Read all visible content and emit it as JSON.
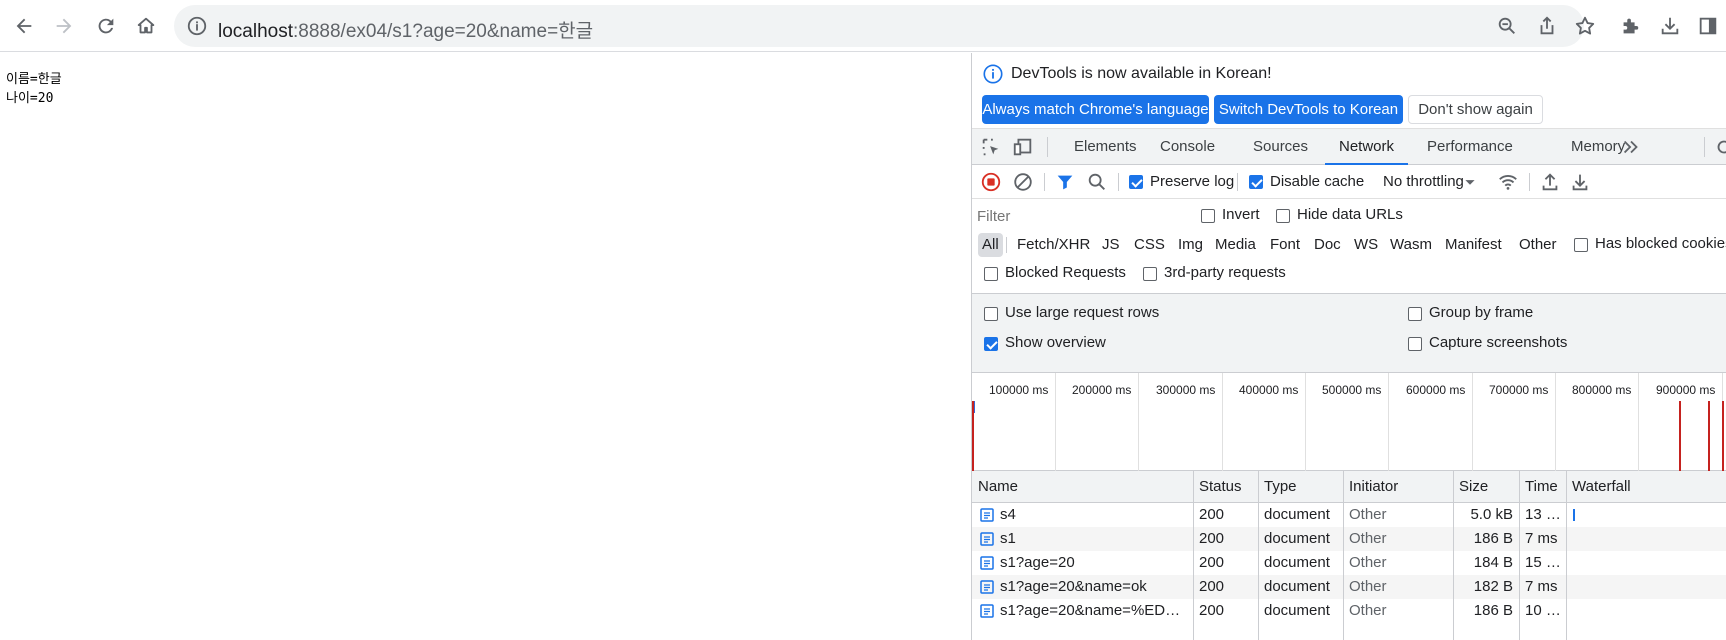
{
  "browser": {
    "url_host": "localhost",
    "url_rest": ":8888/ex04/s1?age=20&name=한글"
  },
  "page": {
    "lines": [
      "이름=한글",
      "나이=20"
    ]
  },
  "devtools": {
    "info_message": "DevTools is now available in Korean!",
    "buttons": {
      "match": "Always match Chrome's language",
      "switch": "Switch DevTools to Korean",
      "dismiss": "Don't show again"
    },
    "tabs": [
      "Elements",
      "Console",
      "Sources",
      "Network",
      "Performance",
      "Memory"
    ],
    "active_tab": "Network",
    "network_toolbar": {
      "preserve_log": "Preserve log",
      "disable_cache": "Disable cache",
      "throttling": "No throttling"
    },
    "filter": {
      "placeholder": "Filter",
      "invert": "Invert",
      "hide_data_urls": "Hide data URLs",
      "types": [
        "All",
        "Fetch/XHR",
        "JS",
        "CSS",
        "Img",
        "Media",
        "Font",
        "Doc",
        "WS",
        "Wasm",
        "Manifest",
        "Other"
      ],
      "has_blocked_cookies": "Has blocked cookies",
      "blocked_requests": "Blocked Requests",
      "third_party": "3rd-party requests"
    },
    "settings": {
      "large_rows": "Use large request rows",
      "group_by_frame": "Group by frame",
      "show_overview": "Show overview",
      "capture_screenshots": "Capture screenshots"
    },
    "overview_ticks": [
      "100000 ms",
      "200000 ms",
      "300000 ms",
      "400000 ms",
      "500000 ms",
      "600000 ms",
      "700000 ms",
      "800000 ms",
      "900000 ms"
    ],
    "table": {
      "headers": [
        "Name",
        "Status",
        "Type",
        "Initiator",
        "Size",
        "Time",
        "Waterfall"
      ],
      "rows": [
        {
          "name": "s4",
          "status": "200",
          "type": "document",
          "initiator": "Other",
          "size": "5.0 kB",
          "time": "13 …"
        },
        {
          "name": "s1",
          "status": "200",
          "type": "document",
          "initiator": "Other",
          "size": "186 B",
          "time": "7 ms"
        },
        {
          "name": "s1?age=20",
          "status": "200",
          "type": "document",
          "initiator": "Other",
          "size": "184 B",
          "time": "15 …"
        },
        {
          "name": "s1?age=20&name=ok",
          "status": "200",
          "type": "document",
          "initiator": "Other",
          "size": "182 B",
          "time": "7 ms"
        },
        {
          "name": "s1?age=20&name=%ED…",
          "status": "200",
          "type": "document",
          "initiator": "Other",
          "size": "186 B",
          "time": "10 …"
        }
      ]
    }
  },
  "colors": {
    "accent": "#1a73e8",
    "record": "#d93025"
  }
}
